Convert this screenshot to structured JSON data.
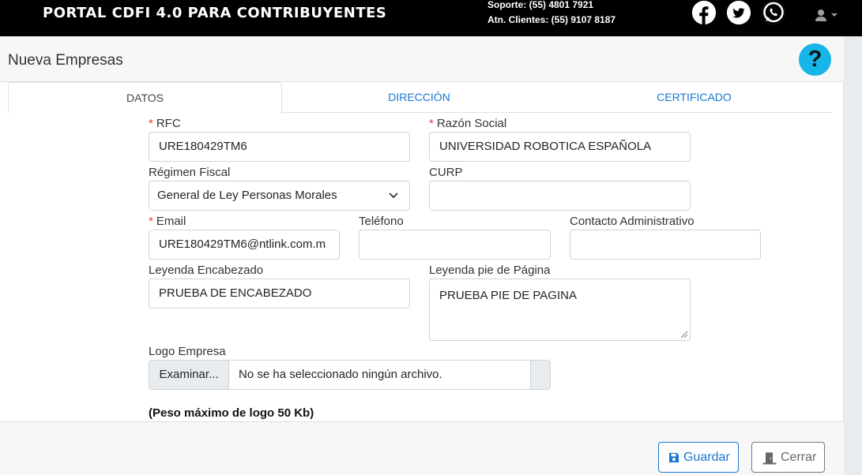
{
  "header": {
    "brand": "PORTAL CDFI 4.0 PARA CONTRIBUYENTES",
    "support_line": "Soporte: (55) 4801 7921",
    "clients_line": "Atn. Clientes: (55) 9107 8187",
    "social": [
      "facebook-icon",
      "twitter-icon",
      "whatsapp-icon"
    ],
    "user_icon": "user-icon"
  },
  "page": {
    "title": "Nueva Empresas",
    "help_label": "?"
  },
  "tabs": [
    {
      "label": "DATOS",
      "active": true
    },
    {
      "label": "DIRECCIÓN",
      "active": false
    },
    {
      "label": "CERTIFICADO",
      "active": false
    }
  ],
  "form": {
    "required_mark": "*",
    "rfc": {
      "label": "RFC",
      "value": "URE180429TM6"
    },
    "razon_social": {
      "label": "Razón Social",
      "value": "UNIVERSIDAD ROBOTICA ESPAÑOLA"
    },
    "regimen": {
      "label": "Régimen Fiscal",
      "value": "General de Ley Personas Morales"
    },
    "curp": {
      "label": "CURP",
      "value": ""
    },
    "email": {
      "label": "Email",
      "value": "URE180429TM6@ntlink.com.m"
    },
    "telefono": {
      "label": "Teléfono",
      "value": ""
    },
    "contacto": {
      "label": "Contacto Administrativo",
      "value": ""
    },
    "encabezado": {
      "label": "Leyenda Encabezado",
      "value": "PRUEBA DE ENCABEZADO"
    },
    "pie": {
      "label": "Leyenda pie de Página",
      "value": "PRUEBA PIE DE PAGINA"
    },
    "logo": {
      "label": "Logo Empresa",
      "button": "Examinar...",
      "file_text": "No se ha seleccionado ningún archivo."
    },
    "note": "(Peso máximo de logo 50 Kb)"
  },
  "footer": {
    "save_label": "Guardar",
    "cancel_label": "Cerrar"
  },
  "colors": {
    "accent": "#1976d2",
    "required": "#e53935",
    "help": "#16b6e8",
    "topbar": "#000000"
  }
}
